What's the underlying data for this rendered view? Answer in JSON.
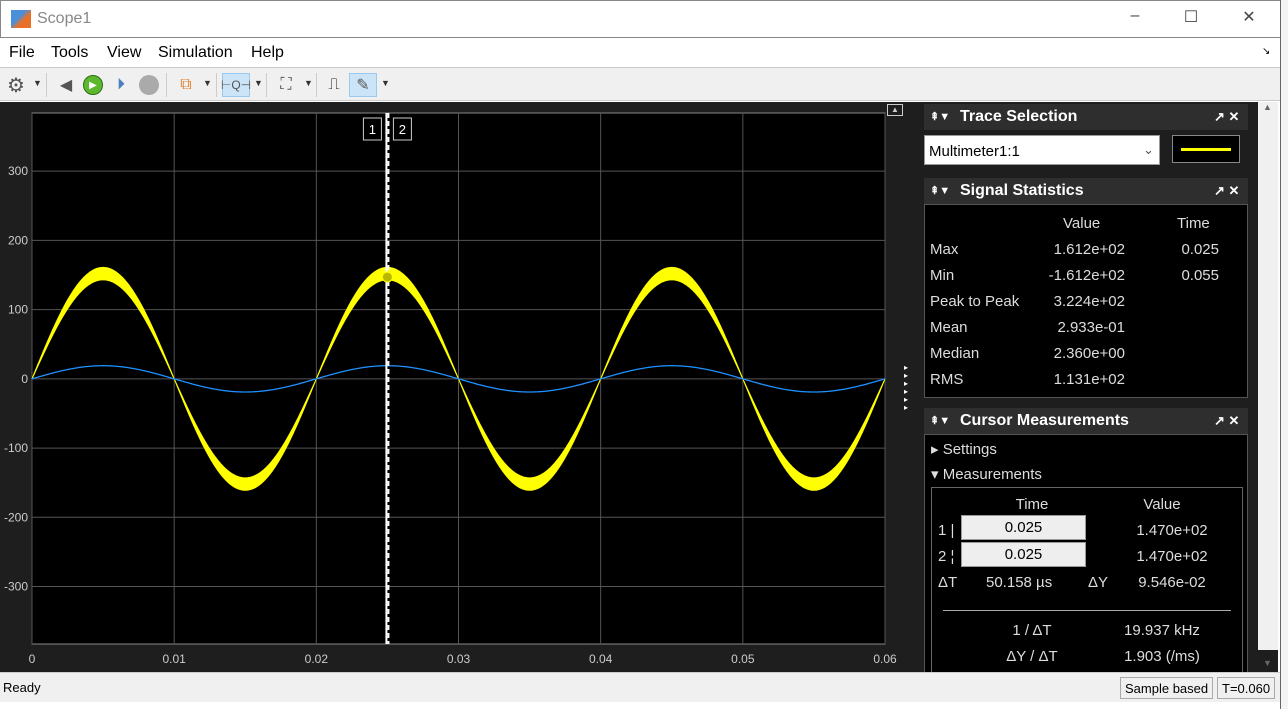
{
  "window": {
    "title": "Scope1",
    "minimize": "–",
    "maximize": "☐",
    "close": "✕"
  },
  "menu": [
    "File",
    "Tools",
    "View",
    "Simulation",
    "Help"
  ],
  "toolbar": {
    "icons": [
      "gear-icon",
      "step-back-icon",
      "run-icon",
      "step-forward-icon",
      "stop-icon",
      "signal-hierarchy-icon",
      "zoom-x-icon",
      "autoscale-icon",
      "triggers-icon",
      "cursor-measurements-icon"
    ]
  },
  "trace_selection": {
    "title": "Trace Selection",
    "selected": "Multimeter1:1",
    "line_color": "#ffff00"
  },
  "signal_statistics": {
    "title": "Signal Statistics",
    "col_value": "Value",
    "col_time": "Time",
    "rows": [
      {
        "label": "Max",
        "value": "1.612e+02",
        "time": "0.025"
      },
      {
        "label": "Min",
        "value": "-1.612e+02",
        "time": "0.055"
      },
      {
        "label": "Peak to Peak",
        "value": "3.224e+02",
        "time": ""
      },
      {
        "label": "Mean",
        "value": "2.933e-01",
        "time": ""
      },
      {
        "label": "Median",
        "value": "2.360e+00",
        "time": ""
      },
      {
        "label": "RMS",
        "value": "1.131e+02",
        "time": ""
      }
    ]
  },
  "cursor_measurements": {
    "title": "Cursor Measurements",
    "settings": "Settings",
    "measurements": "Measurements",
    "col_time": "Time",
    "col_value": "Value",
    "c1_label": "1 |",
    "c1_time": "0.025",
    "c1_value": "1.470e+02",
    "c2_label": "2 ¦",
    "c2_time": "0.025",
    "c2_value": "1.470e+02",
    "dt_label": "ΔT",
    "dt": "50.158 µs",
    "dy_label": "ΔY",
    "dy": "9.546e-02",
    "inv_dt_label": "1 / ΔT",
    "inv_dt": "19.937 kHz",
    "slope_label": "ΔY / ΔT",
    "slope": "1.903 (/ms)"
  },
  "status": {
    "left": "Ready",
    "mode": "Sample based",
    "time": "T=0.060"
  },
  "chart_data": {
    "type": "line",
    "xlim": [
      0,
      0.06
    ],
    "ylim": [
      -383,
      384
    ],
    "xticks": [
      "0",
      "0.01",
      "0.02",
      "0.03",
      "0.04",
      "0.05",
      "0.06"
    ],
    "yticks": [
      "300",
      "200",
      "100",
      "0",
      "-100",
      "-200",
      "-300"
    ],
    "grid": true,
    "series": [
      {
        "color": "#ffff00",
        "frequency_hz": 50,
        "amplitude_band": [
          143,
          161
        ]
      },
      {
        "color": "#1e90ff",
        "frequency_hz": 50,
        "amplitude": 19
      }
    ],
    "cursors": [
      {
        "label": "1",
        "x": 0.025
      },
      {
        "label": "2",
        "x": 0.025
      }
    ],
    "cursor_marker_value": 147
  }
}
